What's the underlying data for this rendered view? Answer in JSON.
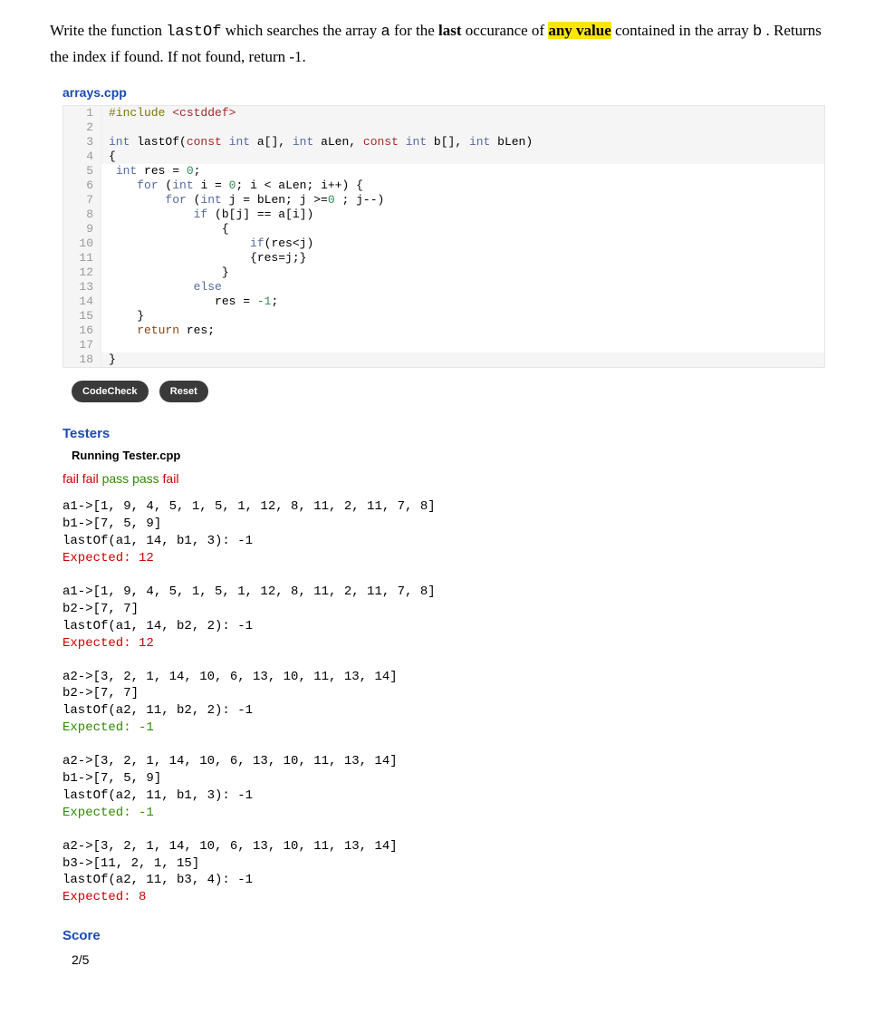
{
  "prompt": {
    "pre1": "Write the function ",
    "fn": "lastOf",
    "mid1": " which searches the array ",
    "arrA": "a",
    "mid2": " for the ",
    "lastWord": "last",
    "mid3": " occurance of ",
    "anyValue": "any value",
    "mid4": " contained in the array ",
    "arrB": "b",
    "tail": ". Returns the index if found. If not found, return -1."
  },
  "filename": "arrays.cpp",
  "code": {
    "l1": {
      "pre": "#include",
      "inc": " <cstddef>"
    },
    "l3": {
      "kw1": "int",
      "fn": " lastOf(",
      "kw2": "const",
      "sp2": " ",
      "kw3": "int",
      "p1": " a[], ",
      "kw4": "int",
      "p2": " aLen, ",
      "kw5": "const",
      "sp5": " ",
      "kw6": "int",
      "p3": " b[], ",
      "kw7": "int",
      "p4": " bLen)"
    },
    "l4": "{",
    "l5": {
      "indent": " ",
      "kw": "int",
      "rest": " res = ",
      "num": "0",
      "semi": ";"
    },
    "l6": {
      "indent": "    ",
      "kw1": "for",
      "p1": " (",
      "kw2": "int",
      "p2": " i = ",
      "num": "0",
      "p3": "; i < aLen; i++) {"
    },
    "l7": {
      "indent": "        ",
      "kw1": "for",
      "p1": " (",
      "kw2": "int",
      "p2": " j = bLen; j >=",
      "num": "0",
      "p3": " ; j--)"
    },
    "l8": {
      "indent": "            ",
      "kw": "if",
      "rest": " (b[j] == a[i])"
    },
    "l9": "                {",
    "l10": {
      "indent": "                    ",
      "kw": "if",
      "rest": "(res<j)"
    },
    "l11": "                    {res=j;}",
    "l12": "                }",
    "l13": {
      "indent": "            ",
      "kw": "else"
    },
    "l14": {
      "indent": "               res = ",
      "num": "-1",
      "semi": ";"
    },
    "l15": "    }",
    "l16": {
      "indent": "    ",
      "kw": "return",
      "rest": " res;"
    },
    "l17": "",
    "l18": "}"
  },
  "buttons": {
    "check": "CodeCheck",
    "reset": "Reset"
  },
  "testers": {
    "title": "Testers",
    "running": "Running Tester.cpp",
    "results": [
      "fail",
      "fail",
      "pass",
      "pass",
      "fail"
    ],
    "cases": [
      {
        "lines": [
          "a1->[1, 9, 4, 5, 1, 5, 1, 12, 8, 11, 2, 11, 7, 8]",
          "b1->[7, 5, 9]",
          "lastOf(a1, 14, b1, 3): -1"
        ],
        "expected": "Expected: 12",
        "ok": false
      },
      {
        "lines": [
          "a1->[1, 9, 4, 5, 1, 5, 1, 12, 8, 11, 2, 11, 7, 8]",
          "b2->[7, 7]",
          "lastOf(a1, 14, b2, 2): -1"
        ],
        "expected": "Expected: 12",
        "ok": false
      },
      {
        "lines": [
          "a2->[3, 2, 1, 14, 10, 6, 13, 10, 11, 13, 14]",
          "b2->[7, 7]",
          "lastOf(a2, 11, b2, 2): -1"
        ],
        "expected": "Expected: -1",
        "ok": true
      },
      {
        "lines": [
          "a2->[3, 2, 1, 14, 10, 6, 13, 10, 11, 13, 14]",
          "b1->[7, 5, 9]",
          "lastOf(a2, 11, b1, 3): -1"
        ],
        "expected": "Expected: -1",
        "ok": true
      },
      {
        "lines": [
          "a2->[3, 2, 1, 14, 10, 6, 13, 10, 11, 13, 14]",
          "b3->[11, 2, 1, 15]",
          "lastOf(a2, 11, b3, 4): -1"
        ],
        "expected": "Expected: 8",
        "ok": false
      }
    ]
  },
  "score": {
    "title": "Score",
    "value": "2/5"
  }
}
